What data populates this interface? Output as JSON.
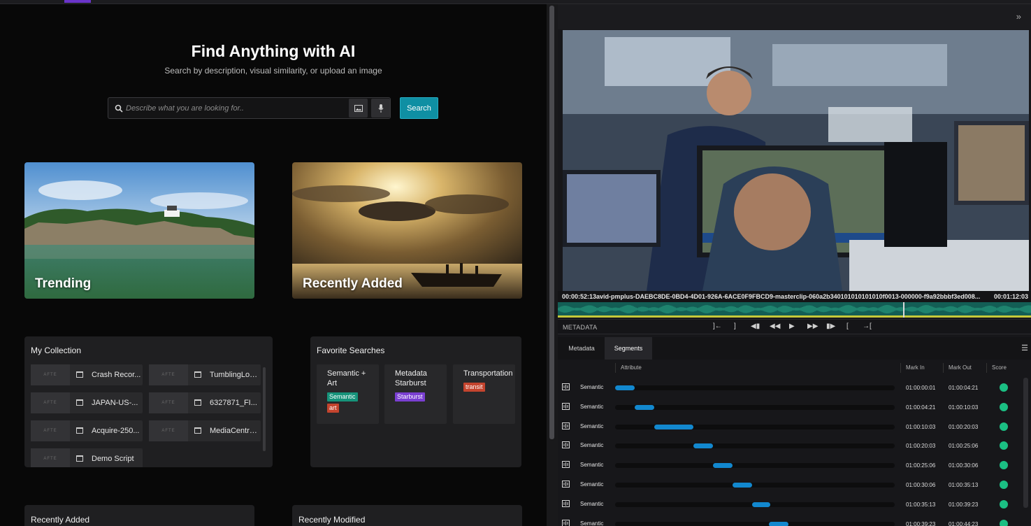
{
  "hero": {
    "title": "Find Anything with AI",
    "subtitle": "Search by description, visual similarity, or upload an image"
  },
  "search": {
    "placeholder": "Describe what you are looking for..",
    "button_label": "Search"
  },
  "tiles": [
    {
      "label": "Trending"
    },
    {
      "label": "Recently Added"
    }
  ],
  "collection": {
    "title": "My Collection",
    "thumb_text": "AFTE",
    "items": [
      {
        "label": "Crash Recor..."
      },
      {
        "label": "TumblingLog..."
      },
      {
        "label": "JAPAN-US-..."
      },
      {
        "label": "6327871_FI..."
      },
      {
        "label": "Acquire-250..."
      },
      {
        "label": "MediaCentra..."
      },
      {
        "label": "Demo Script"
      }
    ]
  },
  "favorites": {
    "title": "Favorite Searches",
    "items": [
      {
        "label": "Semantic + Art",
        "tags": [
          "Semantic",
          "art"
        ]
      },
      {
        "label": "Metadata Starburst",
        "tags": [
          "Starburst"
        ]
      },
      {
        "label": "Transportation",
        "tags": [
          "transit"
        ]
      }
    ],
    "tag_colors": {
      "Semantic": "#16937a",
      "art": "#c4442e",
      "Starburst": "#7a3fd1",
      "transit": "#c4442e"
    }
  },
  "bottom_panels": [
    {
      "title": "Recently Added"
    },
    {
      "title": "Recently Modified"
    }
  ],
  "player": {
    "timecode_start": "00:00:52:13",
    "clip_name": "avid-pmplus-DAEBC8DE-0BD4-4D01-926A-6ACE0F9FBCD9-masterclip-060a2b340101010101010f0013-000000-f9a92bbbf3ed008...",
    "timecode_end": "00:01:12:03",
    "metadata_label": "METADATA",
    "transport_icons": [
      "mark-in-icon",
      "mark-out-icon",
      "step-back-icon",
      "rewind-icon",
      "play-icon",
      "fast-forward-icon",
      "step-forward-icon",
      "go-to-in-icon",
      "go-to-out-icon"
    ],
    "transport_glyphs": [
      "]←",
      "]",
      "◀▮",
      "◀◀",
      "▶",
      "▶▶",
      "▮▶",
      "[",
      "→["
    ]
  },
  "tabs": {
    "metadata": "Metadata",
    "segments": "Segments",
    "active": "Segments"
  },
  "table": {
    "headers": {
      "attribute": "Attribute",
      "mark_in": "Mark In",
      "mark_out": "Mark Out",
      "score": "Score"
    },
    "rows": [
      {
        "type": "Semantic",
        "mark_in": "01:00:00:01",
        "mark_out": "01:00:04:21",
        "start": 0.0,
        "end": 0.07
      },
      {
        "type": "Semantic",
        "mark_in": "01:00:04:21",
        "mark_out": "01:00:10:03",
        "start": 0.07,
        "end": 0.14
      },
      {
        "type": "Semantic",
        "mark_in": "01:00:10:03",
        "mark_out": "01:00:20:03",
        "start": 0.14,
        "end": 0.28
      },
      {
        "type": "Semantic",
        "mark_in": "01:00:20:03",
        "mark_out": "01:00:25:06",
        "start": 0.28,
        "end": 0.35
      },
      {
        "type": "Semantic",
        "mark_in": "01:00:25:06",
        "mark_out": "01:00:30:06",
        "start": 0.35,
        "end": 0.42
      },
      {
        "type": "Semantic",
        "mark_in": "01:00:30:06",
        "mark_out": "01:00:35:13",
        "start": 0.42,
        "end": 0.49
      },
      {
        "type": "Semantic",
        "mark_in": "01:00:35:13",
        "mark_out": "01:00:39:23",
        "start": 0.49,
        "end": 0.55
      },
      {
        "type": "Semantic",
        "mark_in": "01:00:39:23",
        "mark_out": "01:00:44:23",
        "start": 0.55,
        "end": 0.62
      }
    ]
  },
  "colors": {
    "accent": "#0f8fa3",
    "score": "#1bbf83",
    "segment_bar": "#1288cf"
  }
}
